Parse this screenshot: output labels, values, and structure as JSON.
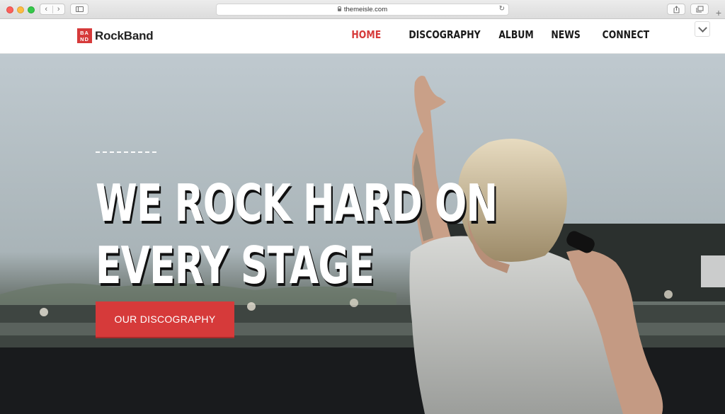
{
  "browser": {
    "url": "themeisle.com",
    "back_glyph": "‹",
    "forward_glyph": "›",
    "reload_glyph": "↻",
    "new_tab_glyph": "+"
  },
  "site": {
    "logo_mark_top": "BA",
    "logo_mark_bottom": "ND",
    "logo_text": "RockBand",
    "nav": [
      {
        "label": "HOME",
        "active": true
      },
      {
        "label": "DISCOGRAPHY",
        "active": false
      },
      {
        "label": "ALBUM",
        "active": false
      },
      {
        "label": "NEWS",
        "active": false
      },
      {
        "label": "CONNECT",
        "active": false
      }
    ]
  },
  "hero": {
    "title_line1": "WE ROCK HARD ON",
    "title_line2": "EVERY STAGE",
    "cta_label": "OUR DISCOGRAPHY"
  },
  "colors": {
    "accent": "#d63a3a",
    "text_dark": "#1a1a1a"
  },
  "icons": [
    "back-icon",
    "forward-icon",
    "sidebar-icon",
    "lock-icon",
    "reload-icon",
    "share-icon",
    "tabs-icon",
    "plus-icon",
    "chevron-down-icon"
  ]
}
